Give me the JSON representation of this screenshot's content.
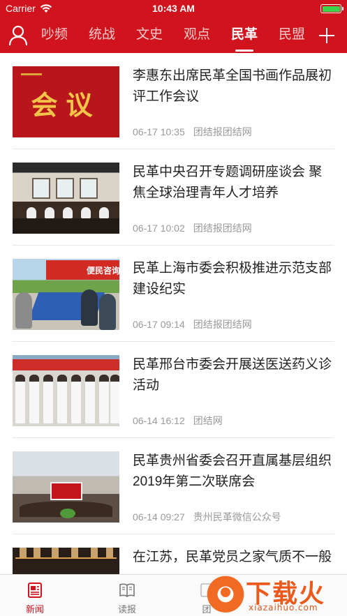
{
  "status_bar": {
    "carrier": "Carrier",
    "time": "10:43 AM",
    "battery_level": 1.0
  },
  "nav": {
    "tabs": [
      {
        "label": "吵频"
      },
      {
        "label": "统战"
      },
      {
        "label": "文史"
      },
      {
        "label": "观点"
      },
      {
        "label": "民革"
      },
      {
        "label": "民盟"
      }
    ],
    "active_tab": "民革"
  },
  "news": [
    {
      "title": "李惠东出席民革全国书画作品展初评工作会议",
      "date": "06-17 10:35",
      "source": "团结报团结网",
      "thumb_text": "会议"
    },
    {
      "title": "民革中央召开专题调研座谈会 聚焦全球治理青年人才培养",
      "date": "06-17 10:02",
      "source": "团结报团结网"
    },
    {
      "title": "民革上海市委会积极推进示范支部建设纪实",
      "date": "06-17 09:14",
      "source": "团结报团结网",
      "thumb_text": "便民咨询"
    },
    {
      "title": "民革邢台市委会开展送医送药义诊活动",
      "date": "06-14 16:12",
      "source": "团结网"
    },
    {
      "title": "民革贵州省委会召开直属基层组织2019年第二次联席会",
      "date": "06-14 09:27",
      "source": "贵州民革微信公众号"
    },
    {
      "title": "在江苏，民革党员之家气质不一般",
      "date": "",
      "source": ""
    }
  ],
  "tabbar": {
    "items": [
      {
        "label": "新闻"
      },
      {
        "label": "读报"
      },
      {
        "label": "团"
      }
    ]
  },
  "watermark": {
    "text": "下载火",
    "url": "xiazaihuo.com"
  },
  "colors": {
    "brand_red": "#d0131c",
    "meta_gray": "#999999",
    "watermark_orange": "#ea5a1c"
  }
}
